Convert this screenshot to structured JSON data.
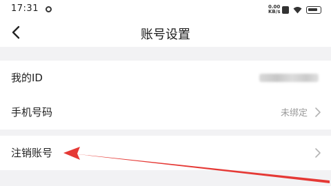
{
  "status_bar": {
    "time": "17:31",
    "net_speed": "0.00 KB/s"
  },
  "header": {
    "title": "账号设置",
    "back_icon": "chevron-left-icon"
  },
  "rows": [
    {
      "label": "我的ID",
      "value_obscured": true
    },
    {
      "label": "手机号码",
      "value": "未绑定"
    },
    {
      "label": "注销账号",
      "value": ""
    }
  ],
  "annotation": {
    "arrow_color": "#e53935"
  },
  "colors": {
    "background": "#f2f2f4",
    "card": "#ffffff",
    "muted": "#9a9a9a"
  }
}
